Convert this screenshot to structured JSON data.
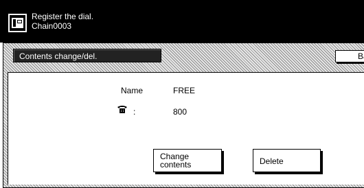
{
  "header": {
    "title": "Register the dial.",
    "subtitle": "Chain0003",
    "icon": "fax-icon"
  },
  "panel": {
    "tab_label": "Contents change/del.",
    "back_label": "Ba"
  },
  "details": {
    "name_label": "Name",
    "name_value": "FREE",
    "phone_icon": "telephone-icon",
    "phone_separator": ":",
    "phone_value": "800"
  },
  "buttons": {
    "change_contents_line1": "Change",
    "change_contents_line2": "contents",
    "delete_label": "Delete"
  },
  "colors": {
    "header_bg": "#000000",
    "tab_bg": "#222222",
    "content_bg": "#ffffff"
  }
}
